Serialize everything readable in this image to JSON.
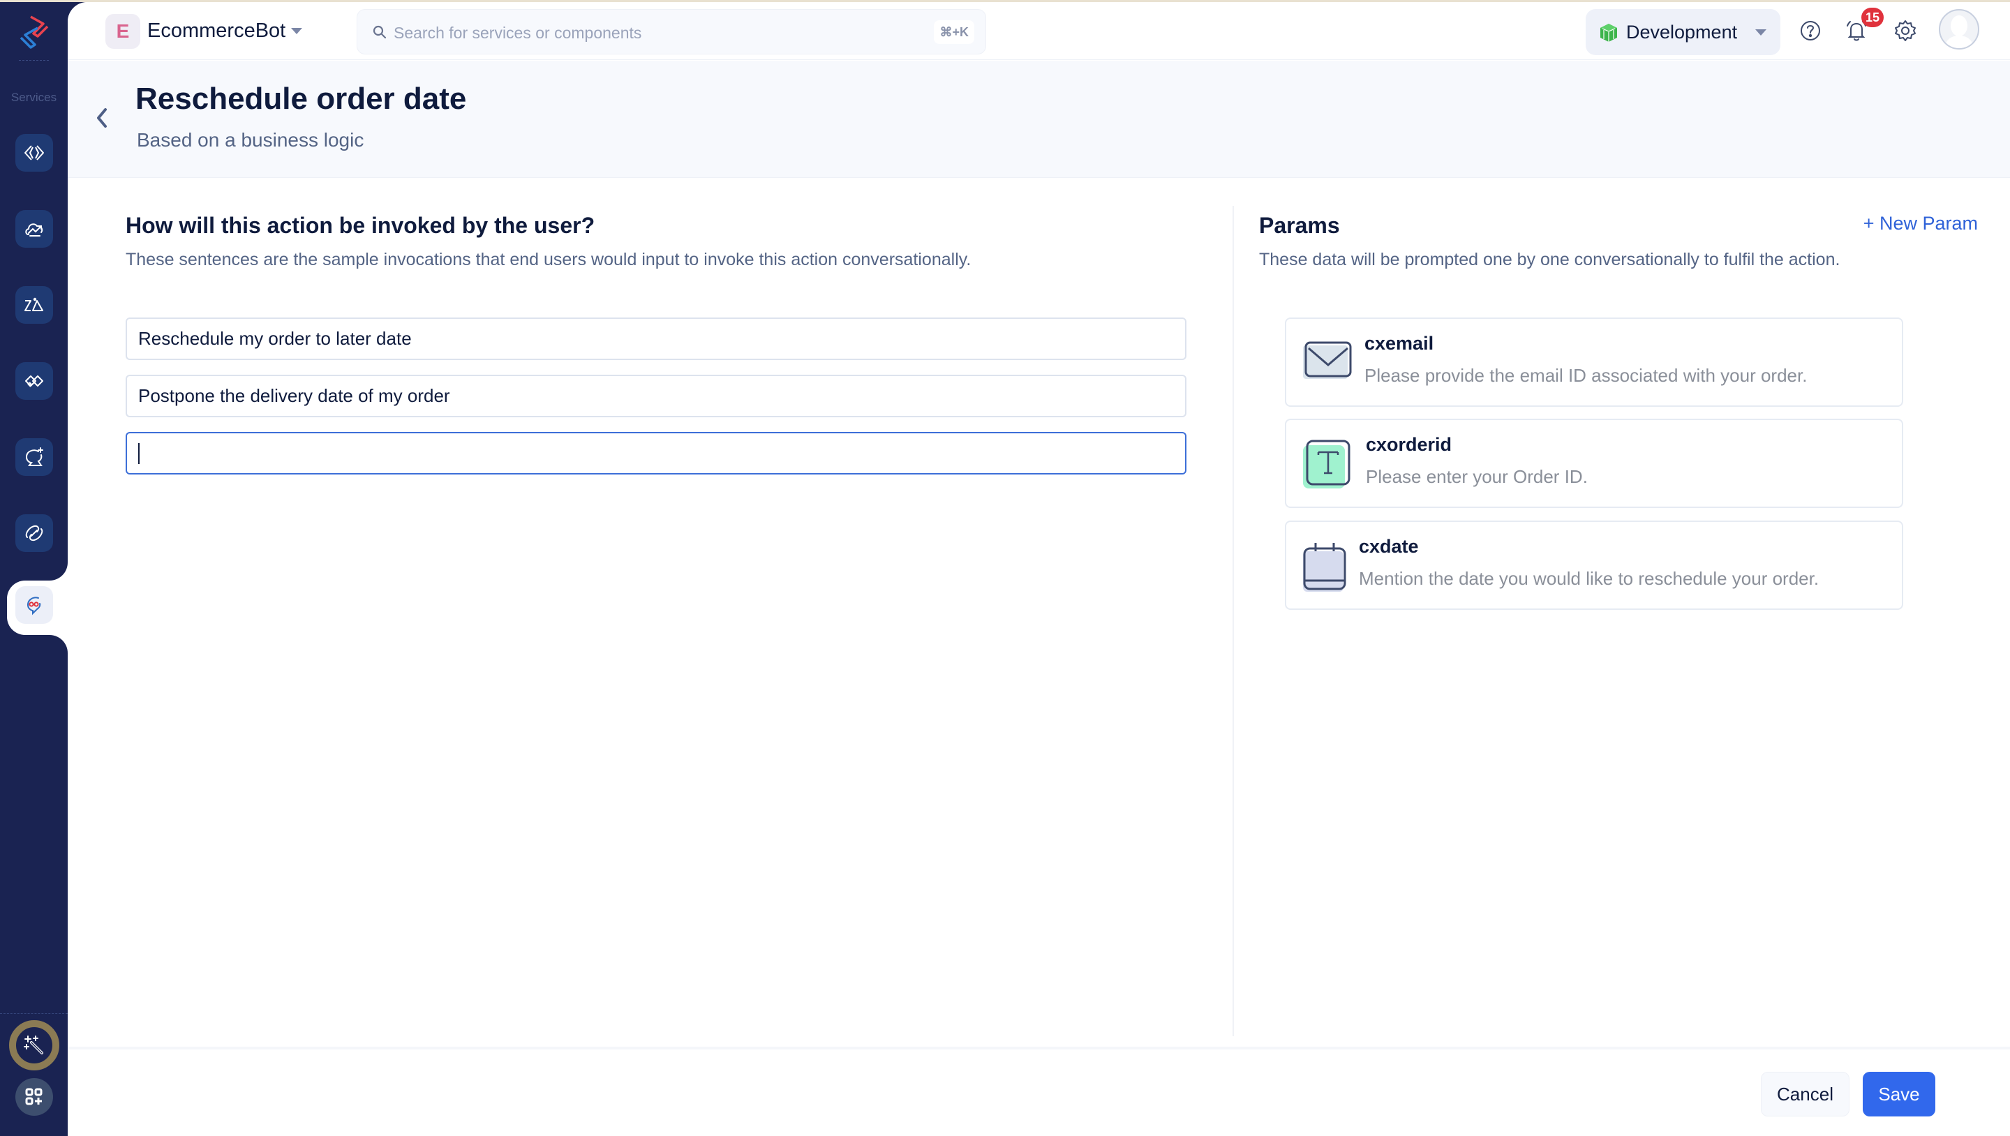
{
  "app": {
    "bot_initial": "E",
    "bot_name": "EcommerceBot",
    "search_placeholder": "Search for services or components",
    "search_shortcut": "⌘+K",
    "environment": "Development",
    "notification_count": "15"
  },
  "sidebar": {
    "section_label": "Services",
    "items": [
      {
        "name": "code-icon"
      },
      {
        "name": "cloud-icon"
      },
      {
        "name": "zia-icon"
      },
      {
        "name": "integration-icon"
      },
      {
        "name": "ai-chat-icon"
      },
      {
        "name": "link-icon"
      },
      {
        "name": "chatbot-icon",
        "active": true
      }
    ],
    "bottom": [
      {
        "name": "magic-wand-icon"
      },
      {
        "name": "add-apps-icon"
      }
    ]
  },
  "page": {
    "title": "Reschedule order date",
    "subtitle": "Based on a business logic"
  },
  "invocations": {
    "title": "How will this action be invoked by the user?",
    "description": "These sentences are the sample invocations that end users would input to invoke this action conversationally.",
    "items": [
      "Reschedule my order to later date",
      "Postpone the delivery date of my order",
      ""
    ]
  },
  "params": {
    "title": "Params",
    "description": "These data will be prompted one by one conversationally to fulfil the action.",
    "new_param_label": "+ New Param",
    "items": [
      {
        "name": "cxemail",
        "prompt": "Please provide the email ID associated with your order.",
        "type": "email"
      },
      {
        "name": "cxorderid",
        "prompt": "Please enter your Order ID.",
        "type": "text"
      },
      {
        "name": "cxdate",
        "prompt": "Mention the date you would like to reschedule your order.",
        "type": "date"
      }
    ]
  },
  "footer": {
    "cancel_label": "Cancel",
    "save_label": "Save"
  },
  "colors": {
    "sidebar_bg": "#1a2352",
    "primary": "#3168ec",
    "badge": "#e0323c",
    "text_dark": "#0f1b3d"
  }
}
